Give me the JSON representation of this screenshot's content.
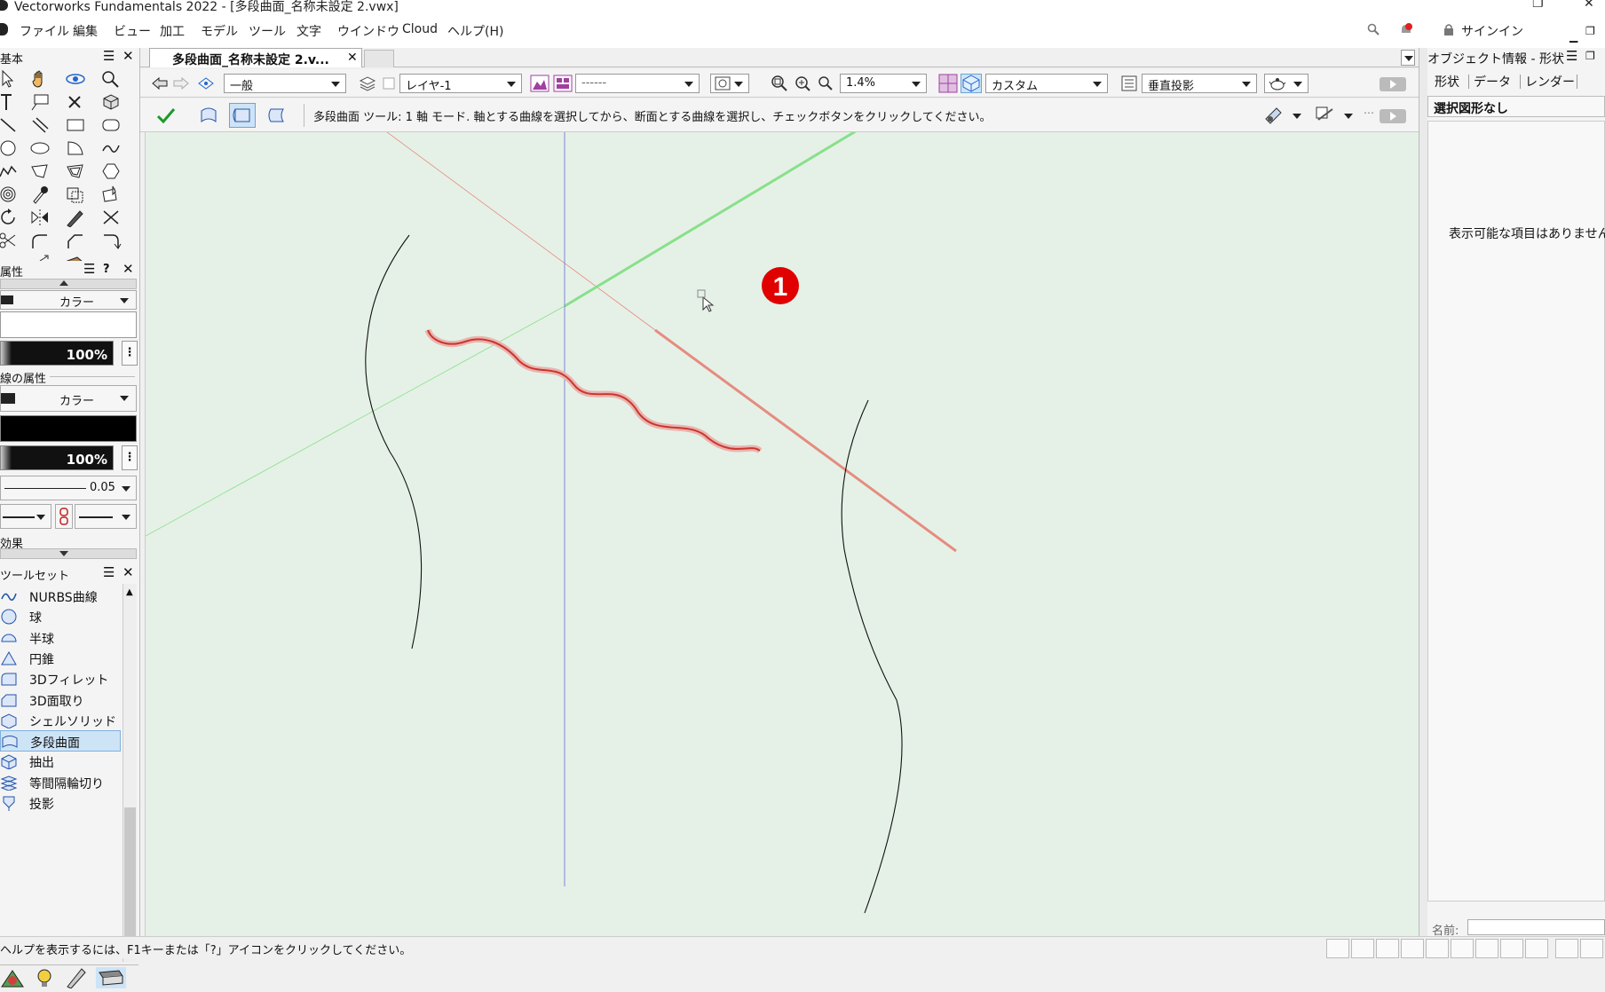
{
  "window": {
    "title": "Vectorworks Fundamentals 2022 - [多段曲面_名称未設定 2.vwx]"
  },
  "menubar": {
    "items": [
      "ファイル",
      "編集",
      "ビュー",
      "加工",
      "モデル",
      "ツール",
      "文字",
      "ウインドウ",
      "Cloud",
      "ヘルプ(H)"
    ],
    "signin": "サインイン"
  },
  "tool_palette": {
    "title": "基本"
  },
  "attributes": {
    "title": "属性",
    "fill_type": "カラー",
    "fill_opacity": "100%",
    "line_section": "線の属性",
    "line_type": "カラー",
    "line_opacity": "100%",
    "line_weight": "0.05",
    "effects": "効果"
  },
  "toolset": {
    "title": "ツールセット",
    "items": [
      {
        "label": "NURBS曲線",
        "icon": "nurbs-curve-icon"
      },
      {
        "label": "球",
        "icon": "sphere-icon"
      },
      {
        "label": "半球",
        "icon": "hemisphere-icon"
      },
      {
        "label": "円錐",
        "icon": "cone-icon"
      },
      {
        "label": "3Dフィレット",
        "icon": "3d-fillet-icon"
      },
      {
        "label": "3D面取り",
        "icon": "3d-chamfer-icon"
      },
      {
        "label": "シェルソリッド",
        "icon": "shell-solid-icon"
      },
      {
        "label": "多段曲面",
        "icon": "loft-surface-icon",
        "selected": true
      },
      {
        "label": "抽出",
        "icon": "extract-icon"
      },
      {
        "label": "等間隔輪切り",
        "icon": "contour-icon"
      },
      {
        "label": "投影",
        "icon": "project-icon"
      }
    ]
  },
  "document_tab": {
    "label": "多段曲面_名称未設定 2.v..."
  },
  "viewbar": {
    "class": "一般",
    "layer": "レイヤ-1",
    "view_name": "------",
    "zoom": "1.4%",
    "render_mode": "カスタム",
    "projection": "垂直投影"
  },
  "modebar": {
    "message": "多段曲面 ツール: 1 軸 モード. 軸とする曲線を選択してから、断面とする曲線を選択し、チェックボタンをクリックしてください。"
  },
  "canvas": {
    "annotation": "1",
    "colors": {
      "background": "#e5f1e7",
      "x_axis": "#e68c80",
      "y_axis": "#88e08a",
      "z_axis": "#7b86d8",
      "highlight": "#d9584e"
    }
  },
  "oip": {
    "title": "オブジェクト情報 - 形状",
    "tabs": [
      "形状",
      "データ",
      "レンダー"
    ],
    "selection": "選択図形なし",
    "empty_message": "表示可能な項目はありません",
    "name_label": "名前:"
  },
  "statusbar": {
    "help": "ヘルプを表示するには、F1キーまたは「?」アイコンをクリックしてください。"
  }
}
